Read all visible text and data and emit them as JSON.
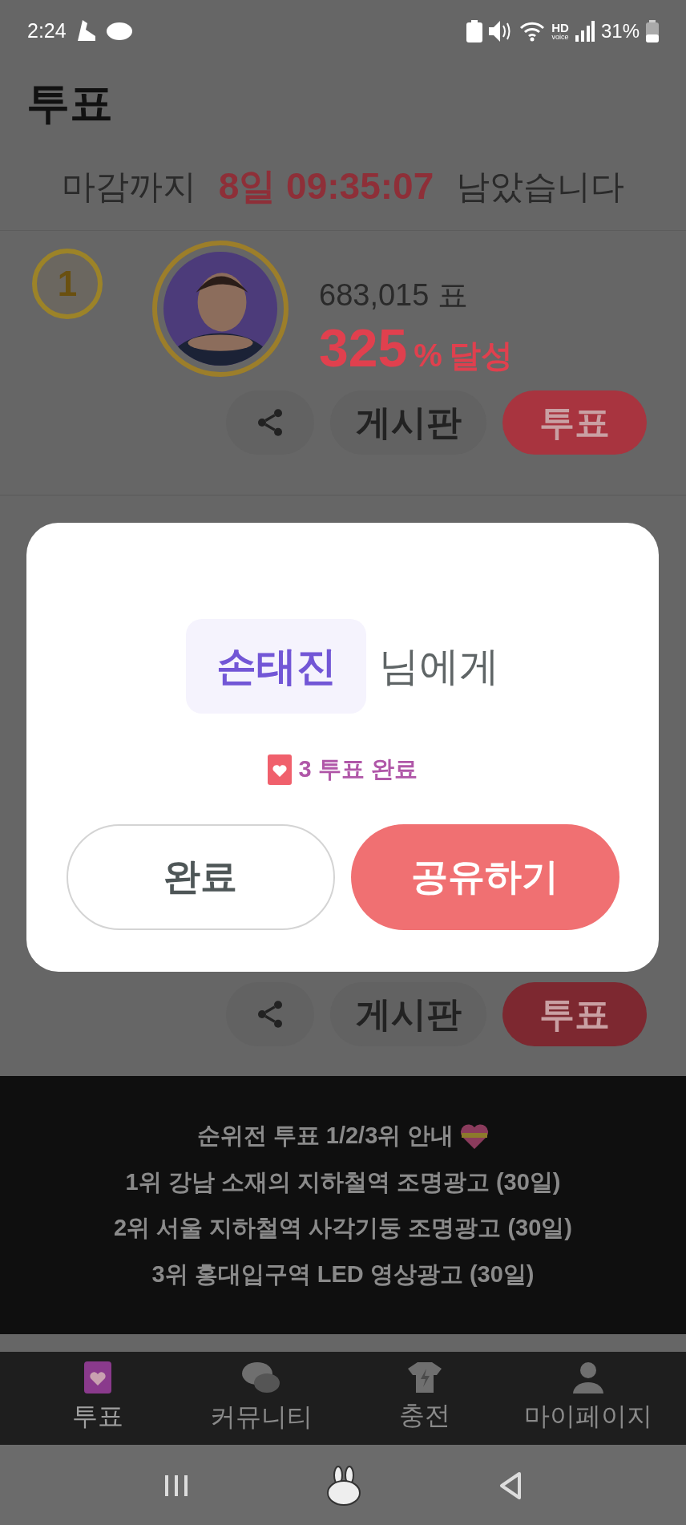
{
  "status_bar": {
    "time": "2:24",
    "network_badge": [
      "HD",
      "voice"
    ],
    "battery": "31%"
  },
  "header": {
    "title": "투표"
  },
  "countdown": {
    "prefix": "마감까지",
    "remaining": "8일 09:35:07",
    "suffix": "남았습니다"
  },
  "candidate": {
    "rank": "1",
    "votes": "683,015 표",
    "percent": "325",
    "percent_unit": "%",
    "percent_label": "달성",
    "board": "게시판",
    "vote": "투표"
  },
  "second_card_buttons": {
    "board": "게시판",
    "vote": "투표"
  },
  "banner": {
    "lines": [
      "순위전 투표 1/2/3위 안내",
      "1위 강남 소재의 지하철역 조명광고 (30일)",
      "2위 서울 지하철역 사각기둥 조명광고 (30일)",
      "3위 홍대입구역 LED 영상광고 (30일)"
    ]
  },
  "bottom_nav": [
    {
      "label": "투표",
      "kind": "vote",
      "selected": true
    },
    {
      "label": "커뮤니티",
      "kind": "community",
      "selected": false
    },
    {
      "label": "충전",
      "kind": "charge",
      "selected": false
    },
    {
      "label": "마이페이지",
      "kind": "mypage",
      "selected": false
    }
  ],
  "dialog": {
    "recipient": "손태진",
    "recipient_suffix": "님에게",
    "result": "3 투표 완료",
    "buttons": [
      {
        "label": "완료",
        "kind": "secondary"
      },
      {
        "label": "공유하기",
        "kind": "primary"
      }
    ]
  }
}
